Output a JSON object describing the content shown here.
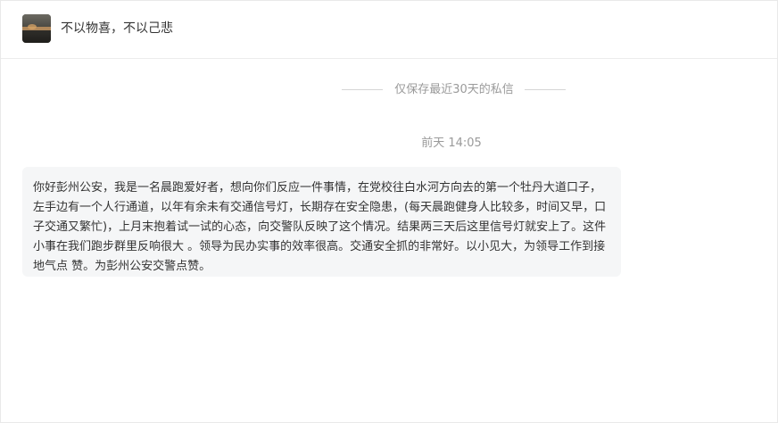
{
  "header": {
    "avatar_icon": "landscape-avatar",
    "title": "不以物喜，不以己悲"
  },
  "conversation": {
    "retention_notice": "仅保存最近30天的私信",
    "timestamp": "前天 14:05",
    "message": "你好彭州公安，我是一名晨跑爱好者，想向你们反应一件事情，在党校往白水河方向去的第一个牡丹大道口子，左手边有一个人行通道，以年有余未有交通信号灯，长期存在安全隐患，(每天晨跑健身人比较多，时间又早，口子交通又繁忙)，上月末抱着试一试的心态，向交警队反映了这个情况。结果两三天后这里信号灯就安上了。这件小事在我们跑步群里反响很大 。领导为民办实事的效率很高。交通安全抓的非常好。以小见大，为领导工作到接地气点 赞。为彭州公安交警点赞。"
  },
  "colors": {
    "bubble_background": "#f5f6f7",
    "muted_text": "#9a9a9a",
    "primary_text": "#333333"
  }
}
